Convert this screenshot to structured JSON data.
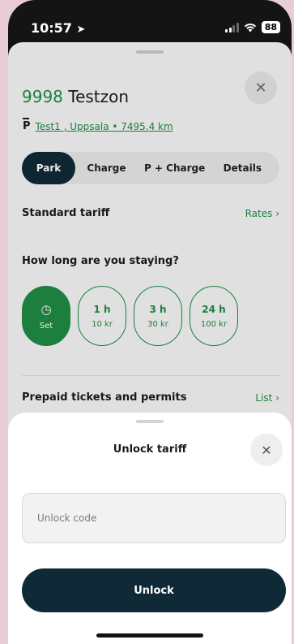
{
  "status": {
    "time": "10:57",
    "battery": "88"
  },
  "zone": {
    "number": "9998",
    "name": "Testzon",
    "location": "Test1 , Uppsala • 7495.4 km"
  },
  "tabs": [
    {
      "label": "Park"
    },
    {
      "label": "Charge"
    },
    {
      "label": "P + Charge"
    },
    {
      "label": "Details"
    }
  ],
  "tariff": {
    "label": "Standard tariff",
    "link": "Rates ›"
  },
  "duration": {
    "question": "How long are you staying?",
    "set_label": "Set",
    "options": [
      {
        "time": "1 h",
        "price": "10 kr"
      },
      {
        "time": "3 h",
        "price": "30 kr"
      },
      {
        "time": "24 h",
        "price": "100 kr"
      }
    ]
  },
  "prepaid": {
    "label": "Prepaid tickets and permits",
    "link": "List ›"
  },
  "modal": {
    "title": "Unlock tariff",
    "input_placeholder": "Unlock code",
    "input_value": "",
    "button_label": "Unlock"
  },
  "colors": {
    "accent": "#1f8a43",
    "dark": "#0f2a36"
  }
}
